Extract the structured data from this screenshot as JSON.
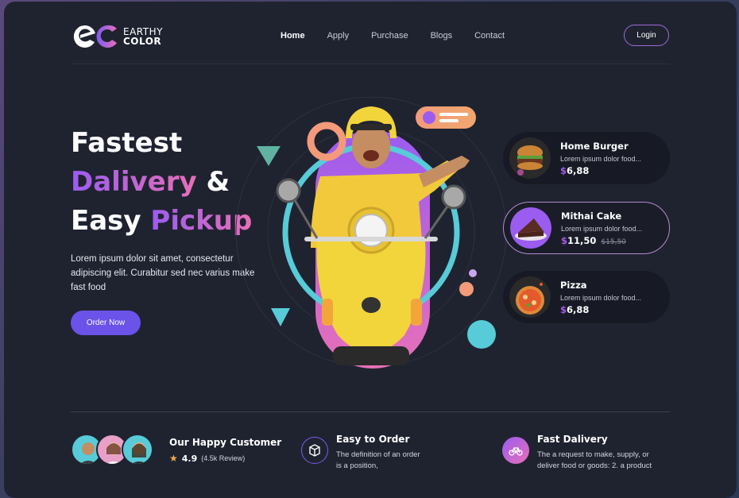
{
  "brand": {
    "line1": "EARTHY",
    "line2": "COLOR"
  },
  "nav": {
    "items": [
      "Home",
      "Apply",
      "Purchase",
      "Blogs",
      "Contact"
    ],
    "active": "Home",
    "login_label": "Login"
  },
  "hero": {
    "title_line1": "Fastest",
    "title_line2_highlight": "Dalivery",
    "title_line2_rest": " &",
    "title_line3_plain": "Easy ",
    "title_line3_highlight": "Pickup",
    "description": "Lorem ipsum dolor sit amet, consectetur adipiscing elit. Curabitur sed nec varius make fast food",
    "cta_label": "Order Now"
  },
  "products": [
    {
      "name": "Home Burger",
      "desc": "Lorem ipsum dolor food...",
      "currency": "$",
      "price": "6,88",
      "old_price": ""
    },
    {
      "name": "Mithai Cake",
      "desc": "Lorem ipsum dolor food...",
      "currency": "$",
      "price": "11,50",
      "old_price": "$15,50"
    },
    {
      "name": "Pizza",
      "desc": "Lorem ipsum dolor food...",
      "currency": "$",
      "price": "6,88",
      "old_price": ""
    }
  ],
  "customers": {
    "title": "Our Happy Customer",
    "rating": "4.9",
    "reviews": "(4.5k Review)"
  },
  "features": [
    {
      "title": "Easy to Order",
      "desc_line1": "The definition of an order",
      "desc_line2": "is a position,",
      "icon": "box-icon"
    },
    {
      "title": "Fast Dalivery",
      "desc_line1": "The a request to make, supply, or",
      "desc_line2": "deliver food or goods: 2. a product",
      "icon": "bicycle-icon"
    }
  ],
  "colors": {
    "background": "#1f2330",
    "accent_purple": "#6b52e8",
    "accent_pink": "#e86fb8",
    "price_purple": "#a35be8",
    "star": "#f3a94b",
    "cyan": "#58cbd8",
    "peach": "#f39a7a",
    "yellow": "#f2d43b"
  }
}
